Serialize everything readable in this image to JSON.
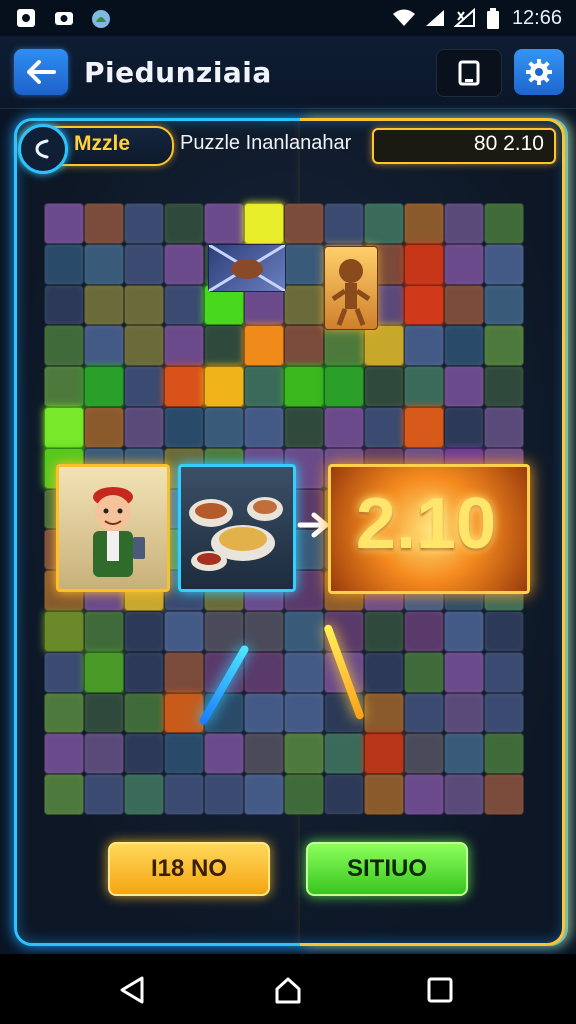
{
  "status_bar": {
    "time": "12:66",
    "icons": [
      "notification-icon",
      "camera-icon",
      "weather-icon",
      "wifi-icon",
      "signal-icon",
      "no-signal-icon",
      "battery-icon"
    ]
  },
  "app_bar": {
    "title": "Piedunziaia",
    "back_icon": "arrow-left-icon",
    "tablet_icon": "tablet-icon",
    "settings_icon": "gear-icon"
  },
  "game_header": {
    "mode_label": "Mzzle",
    "subtitle": "Puzzle Inanlanahar",
    "score": "80 2.10"
  },
  "board": {
    "rows": 15,
    "columns": 12,
    "featured_value": "2.10",
    "cards": [
      "character-card",
      "food-card",
      "result-card"
    ]
  },
  "actions": {
    "left_button": "I18 NO",
    "right_button": "SITIUO"
  },
  "colors": {
    "frame_blue": "#2ec3ff",
    "frame_gold": "#ffc52e",
    "accent_blue": "#2f8ef2",
    "button_gold": "#f5a512",
    "button_green": "#38c51f"
  }
}
